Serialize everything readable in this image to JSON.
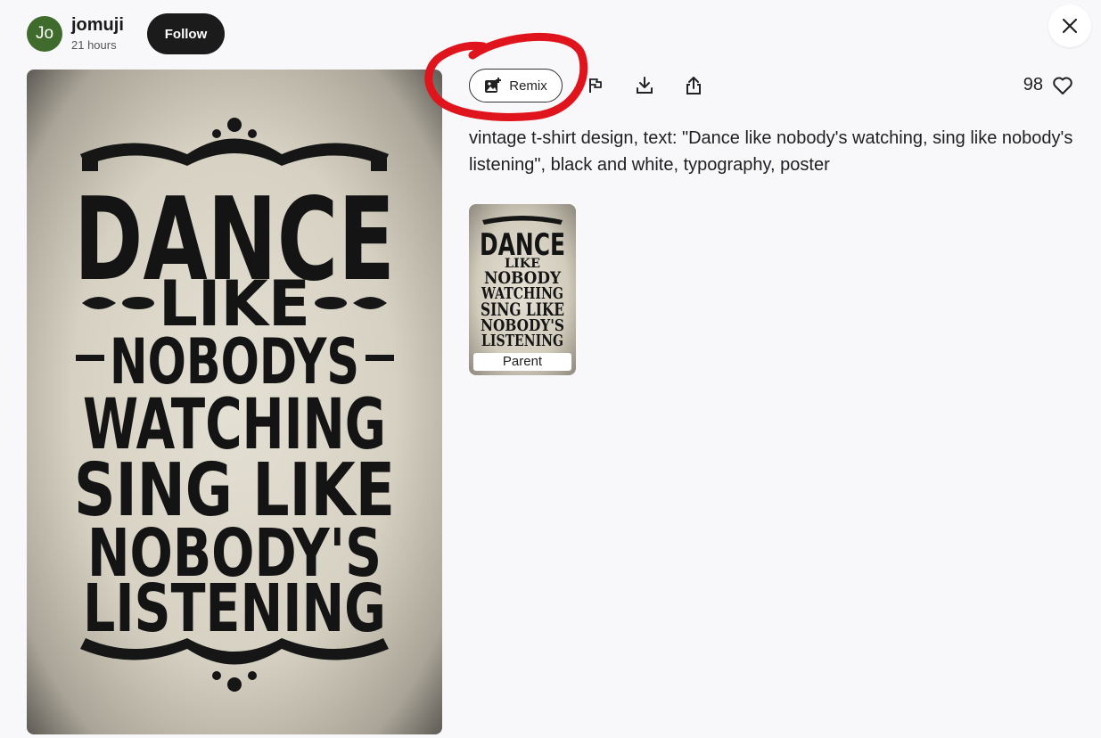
{
  "header": {
    "avatar_initials": "Jo",
    "username": "jomuji",
    "timestamp": "21 hours",
    "follow_label": "Follow"
  },
  "toolbar": {
    "remix_label": "Remix",
    "like_count": "98",
    "icons": [
      "remix-image-icon",
      "flag-icon",
      "download-icon",
      "share-icon",
      "heart-icon",
      "close-icon"
    ]
  },
  "image": {
    "lines": [
      "DANCE",
      "LIKE",
      "NOBODYS",
      "WATCHING",
      "SING LIKE",
      "NOBODY'S",
      "LISTENING"
    ]
  },
  "prompt": "vintage t-shirt design, text: \"Dance like nobody's watching, sing like nobody's listening\", black and white, typography, poster",
  "parent": {
    "label": "Parent",
    "lines": [
      "DANCE",
      "LIKE",
      "NOBODY",
      "WATCHING",
      "SING LIKE",
      "NOBODY'S",
      "LISTENING"
    ]
  },
  "colors": {
    "annotation": "#e0141c",
    "avatar_bg": "#3f6b2c",
    "follow_bg": "#1b1b1b"
  }
}
